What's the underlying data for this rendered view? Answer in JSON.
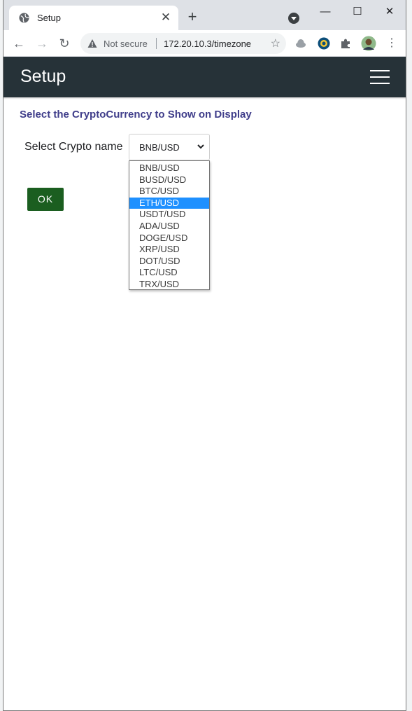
{
  "browser": {
    "tab_title": "Setup",
    "tab_close": "✕",
    "new_tab": "+",
    "security_label": "Not secure",
    "url": "172.20.10.3/timezone",
    "controls": {
      "minimize": "—",
      "maximize": "☐",
      "close": "✕"
    }
  },
  "app": {
    "title": "Setup",
    "heading": "Select the CryptoCurrency to Show on Display"
  },
  "form": {
    "label": "Select Crypto name",
    "selected_value": "BNB/USD",
    "highlighted_option": "ETH/USD",
    "options": [
      "BNB/USD",
      "BUSD/USD",
      "BTC/USD",
      "ETH/USD",
      "USDT/USD",
      "ADA/USD",
      "DOGE/USD",
      "XRP/USD",
      "DOT/USD",
      "LTC/USD",
      "TRX/USD"
    ],
    "ok_label": "OK"
  },
  "colors": {
    "appbar": "#263238",
    "heading": "#3f3d8a",
    "ok_button": "#1b5e20",
    "selection": "#1e90ff"
  }
}
